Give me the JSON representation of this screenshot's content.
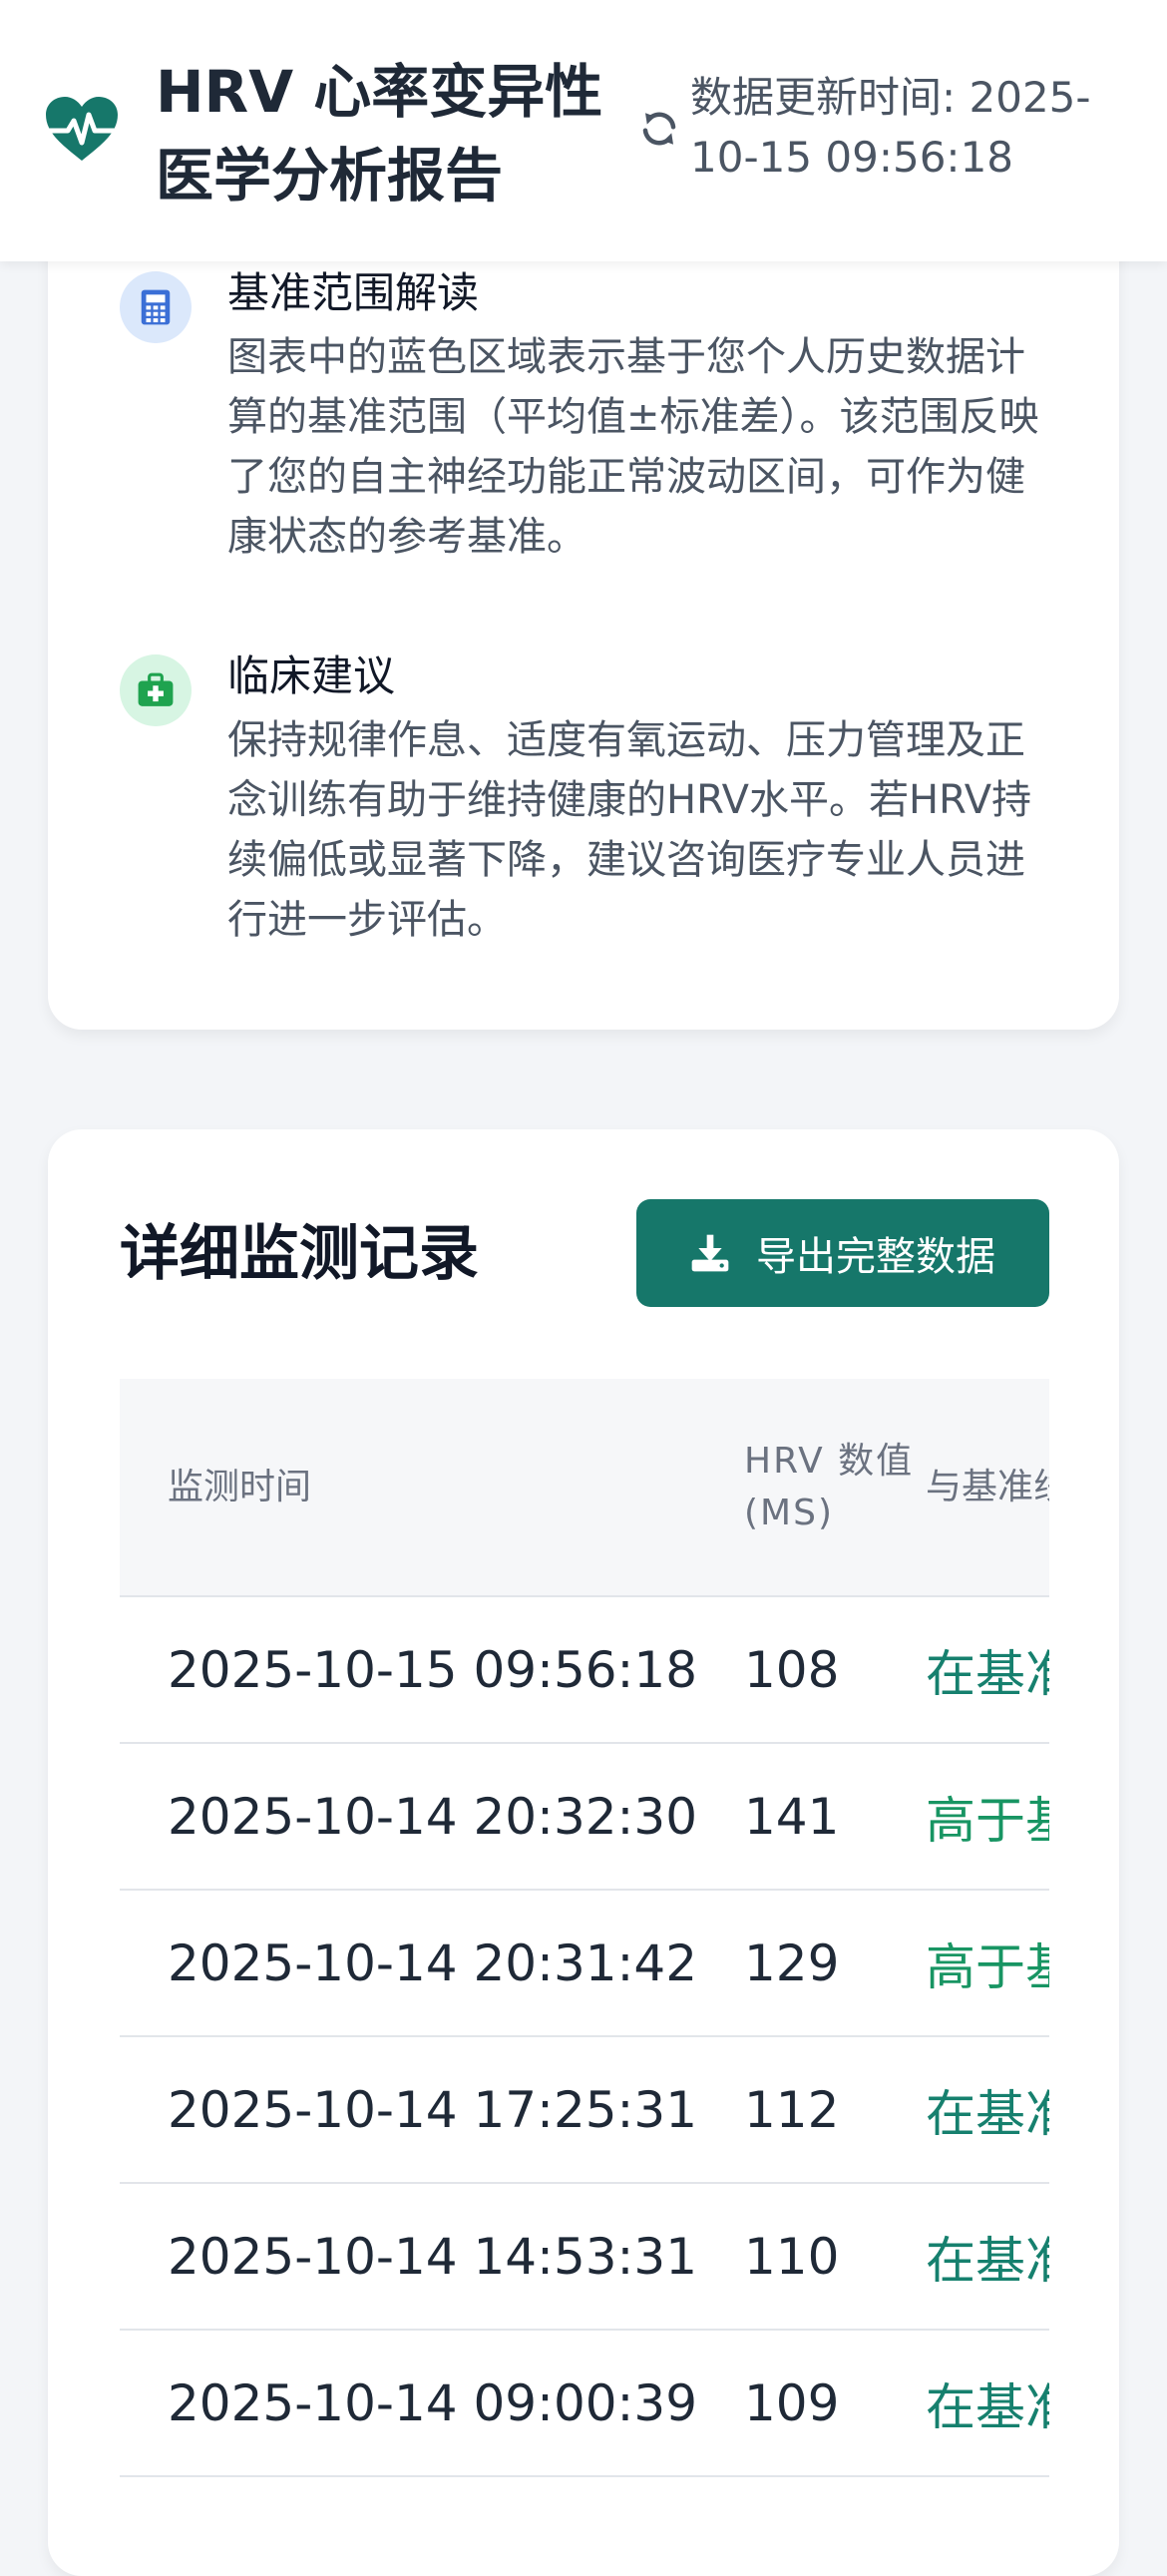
{
  "header": {
    "title": "HRV 心率变异性医学分析报告",
    "updated": "数据更新时间: 2025-10-15 09:56:18",
    "logo_icon": "heart-pulse-icon",
    "sync_icon": "sync-icon",
    "accent": "#16776a"
  },
  "info": [
    {
      "icon": "calculator-icon",
      "title": "基准范围解读",
      "body": "图表中的蓝色区域表示基于您个人历史数据计算的基准范围（平均值±标准差）。该范围反映了您的自主神经功能正常波动区间，可作为健康状态的参考基准。"
    },
    {
      "icon": "medical-kit-icon",
      "title": "临床建议",
      "body": "保持规律作息、适度有氧运动、压力管理及正念训练有助于维持健康的HRV水平。若HRV持续偏低或显著下降，建议咨询医疗专业人员进行进一步评估。"
    }
  ],
  "records": {
    "title": "详细监测记录",
    "export_label": "导出完整数据",
    "export_icon": "download-icon",
    "columns": [
      "监测时间",
      "HRV 数值 (MS)",
      "与基准线对比"
    ],
    "rows": [
      {
        "time": "2025-10-15 09:56:18",
        "hrv": "108",
        "status": "在基准范围内"
      },
      {
        "time": "2025-10-14 20:32:30",
        "hrv": "141",
        "status": "高于基准范围"
      },
      {
        "time": "2025-10-14 20:31:42",
        "hrv": "129",
        "status": "高于基准范围"
      },
      {
        "time": "2025-10-14 17:25:31",
        "hrv": "112",
        "status": "在基准范围内"
      },
      {
        "time": "2025-10-14 14:53:31",
        "hrv": "110",
        "status": "在基准范围内"
      },
      {
        "time": "2025-10-14 09:00:39",
        "hrv": "109",
        "status": "在基准范围内"
      }
    ]
  }
}
